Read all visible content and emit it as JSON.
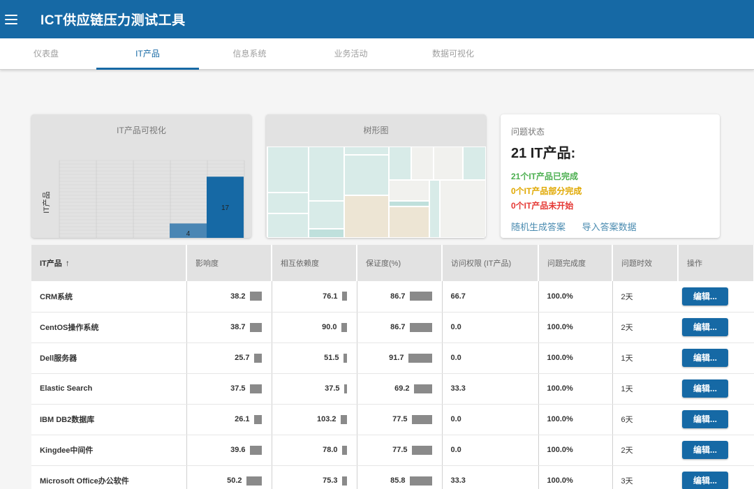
{
  "app": {
    "title": "ICT供应链压力测试工具"
  },
  "tabs": [
    {
      "label": "仪表盘"
    },
    {
      "label": "IT产品"
    },
    {
      "label": "信息系统"
    },
    {
      "label": "业务活动"
    },
    {
      "label": "数据可视化"
    }
  ],
  "viz_card": {
    "title": "IT产品可视化",
    "ylabel": "IT产品"
  },
  "tree_card": {
    "title": "树形图"
  },
  "chart_data": {
    "type": "bar",
    "values": [
      4,
      17
    ],
    "data_labels": [
      "4",
      "17"
    ],
    "ylabel": "IT产品",
    "grid": true,
    "colors": [
      "#4a86b4",
      "#1669a5"
    ]
  },
  "status_card": {
    "label": "问题状态",
    "count": "21 IT产品:",
    "done": "21个IT产品已完成",
    "partial": "0个IT产品部分完成",
    "not_started": "0个IT产品未开始",
    "link_random": "随机生成答案",
    "link_import": "导入答案数据"
  },
  "table": {
    "headers": [
      "IT产品",
      "影响度",
      "相互依赖度",
      "保证度(%)",
      "访问权限 (IT产品)",
      "问题完成度",
      "问题时效",
      "操作"
    ],
    "edit_label": "编辑...",
    "rows": [
      {
        "name": "CRM系统",
        "impact": "38.2",
        "dep": "76.1",
        "assur": "86.7",
        "access": "66.7",
        "done": "100.0%",
        "time": "2天"
      },
      {
        "name": "CentOS操作系统",
        "impact": "38.7",
        "dep": "90.0",
        "assur": "86.7",
        "access": "0.0",
        "done": "100.0%",
        "time": "2天"
      },
      {
        "name": "Dell服务器",
        "impact": "25.7",
        "dep": "51.5",
        "assur": "91.7",
        "access": "0.0",
        "done": "100.0%",
        "time": "1天"
      },
      {
        "name": "Elastic Search",
        "impact": "37.5",
        "dep": "37.5",
        "assur": "69.2",
        "access": "33.3",
        "done": "100.0%",
        "time": "1天"
      },
      {
        "name": "IBM DB2数据库",
        "impact": "26.1",
        "dep": "103.2",
        "assur": "77.5",
        "access": "0.0",
        "done": "100.0%",
        "time": "6天"
      },
      {
        "name": "Kingdee中间件",
        "impact": "39.6",
        "dep": "78.0",
        "assur": "77.5",
        "access": "0.0",
        "done": "100.0%",
        "time": "2天"
      },
      {
        "name": "Microsoft Office办公软件",
        "impact": "50.2",
        "dep": "75.3",
        "assur": "85.8",
        "access": "33.3",
        "done": "100.0%",
        "time": "3天"
      }
    ]
  }
}
